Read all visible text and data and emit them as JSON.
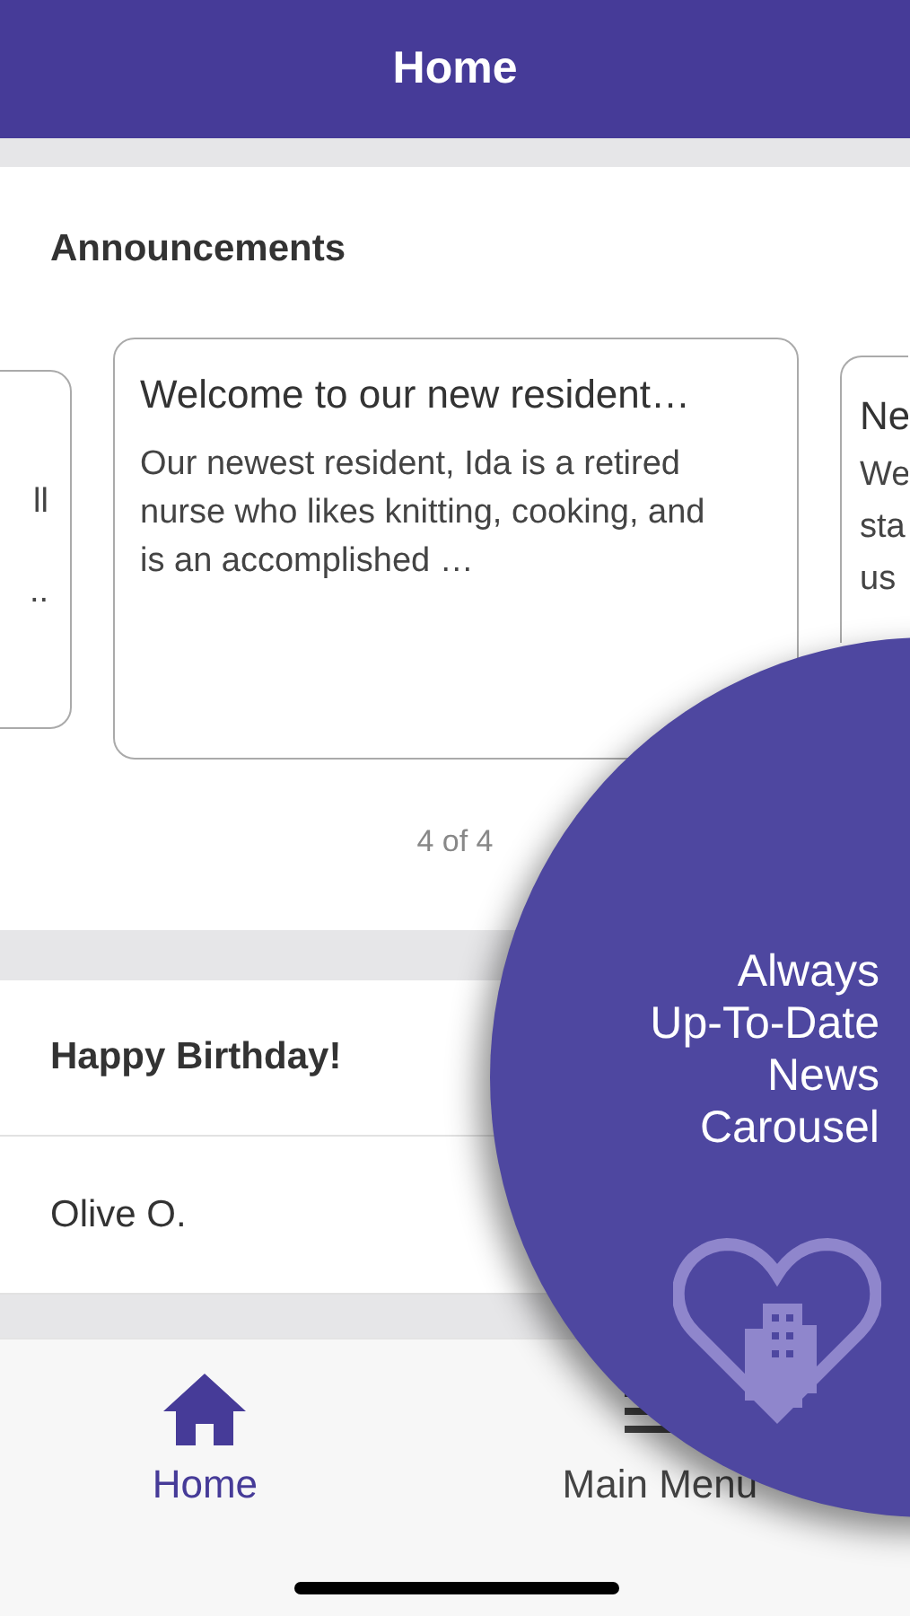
{
  "header": {
    "title": "Home"
  },
  "announcements": {
    "title": "Announcements",
    "pager": "4 of 4",
    "cards": [
      {
        "kind": "partial-left",
        "lines": [
          "ll",
          ".."
        ]
      },
      {
        "kind": "full",
        "title": "Welcome to our new resident…",
        "body": "Our newest resident, Ida is a retired nurse who likes knitting, cooking, and is an accomplished …"
      },
      {
        "kind": "partial-right",
        "title": "Ne",
        "lines": [
          "We",
          "sta",
          "us"
        ]
      }
    ]
  },
  "birthday": {
    "title": "Happy Birthday!",
    "names": [
      "Olive O."
    ]
  },
  "tabs": [
    {
      "label": "Home",
      "kind": "home",
      "selected": true
    },
    {
      "label": "Main Menu",
      "kind": "menu",
      "selected": false
    }
  ],
  "promo": {
    "lines": [
      "Always",
      "Up-To-Date",
      "News",
      "Carousel"
    ]
  }
}
